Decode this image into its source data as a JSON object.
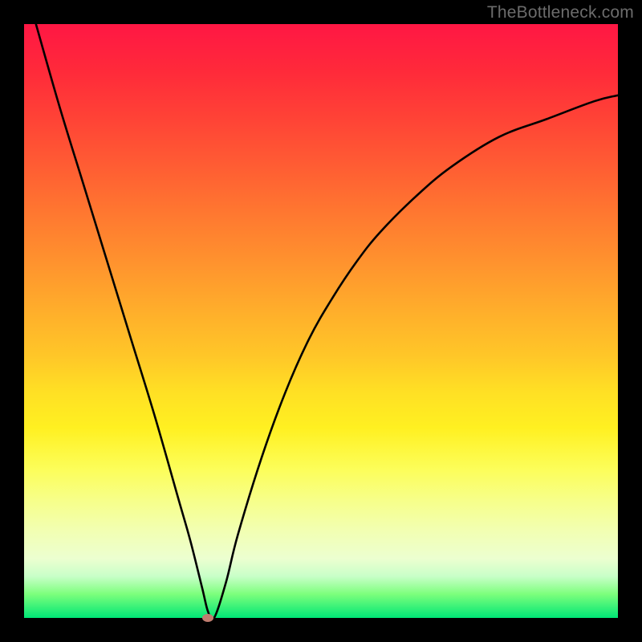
{
  "watermark_text": "TheBottleneck.com",
  "chart_data": {
    "type": "line",
    "title": "",
    "xlabel": "",
    "ylabel": "",
    "xlim": [
      0,
      100
    ],
    "ylim": [
      0,
      100
    ],
    "grid": false,
    "legend": false,
    "series": [
      {
        "name": "bottleneck-curve",
        "x": [
          2,
          6,
          10,
          14,
          18,
          22,
          26,
          28,
          30,
          31,
          32,
          34,
          36,
          40,
          44,
          48,
          52,
          56,
          60,
          66,
          72,
          80,
          88,
          96,
          100
        ],
        "values": [
          100,
          86,
          73,
          60,
          47,
          34,
          20,
          13,
          5,
          1,
          0,
          6,
          14,
          27,
          38,
          47,
          54,
          60,
          65,
          71,
          76,
          81,
          84,
          87,
          88
        ]
      }
    ],
    "minimum_point": {
      "x": 31,
      "y": 0
    },
    "gradient_stops": [
      {
        "pos": 0.0,
        "color": "#ff1744"
      },
      {
        "pos": 0.5,
        "color": "#ffc728"
      },
      {
        "pos": 0.75,
        "color": "#fcfe5a"
      },
      {
        "pos": 1.0,
        "color": "#00e676"
      }
    ]
  }
}
